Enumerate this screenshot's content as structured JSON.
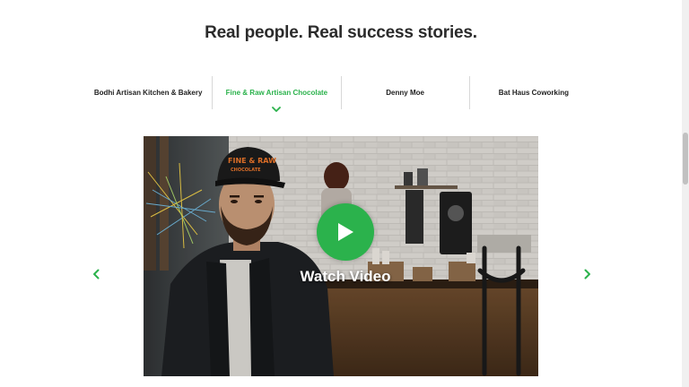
{
  "section": {
    "title": "Real people. Real success stories."
  },
  "tabs": [
    {
      "label": "Bodhi Artisan Kitchen & Bakery",
      "active": false
    },
    {
      "label": "Fine & Raw Artisan Chocolate",
      "active": true
    },
    {
      "label": "Denny Moe",
      "active": false
    },
    {
      "label": "Bat Haus Coworking",
      "active": false
    }
  ],
  "video": {
    "cta_label": "Watch Video",
    "cap_text_line1": "FINE & RAW",
    "cap_text_line2": "CHOCOLATE"
  },
  "carousel": {
    "prev_icon": "chevron-left-icon",
    "next_icon": "chevron-right-icon"
  },
  "colors": {
    "accent": "#2bb24c",
    "title": "#2b2b2b",
    "divider": "#d8d8d8"
  }
}
